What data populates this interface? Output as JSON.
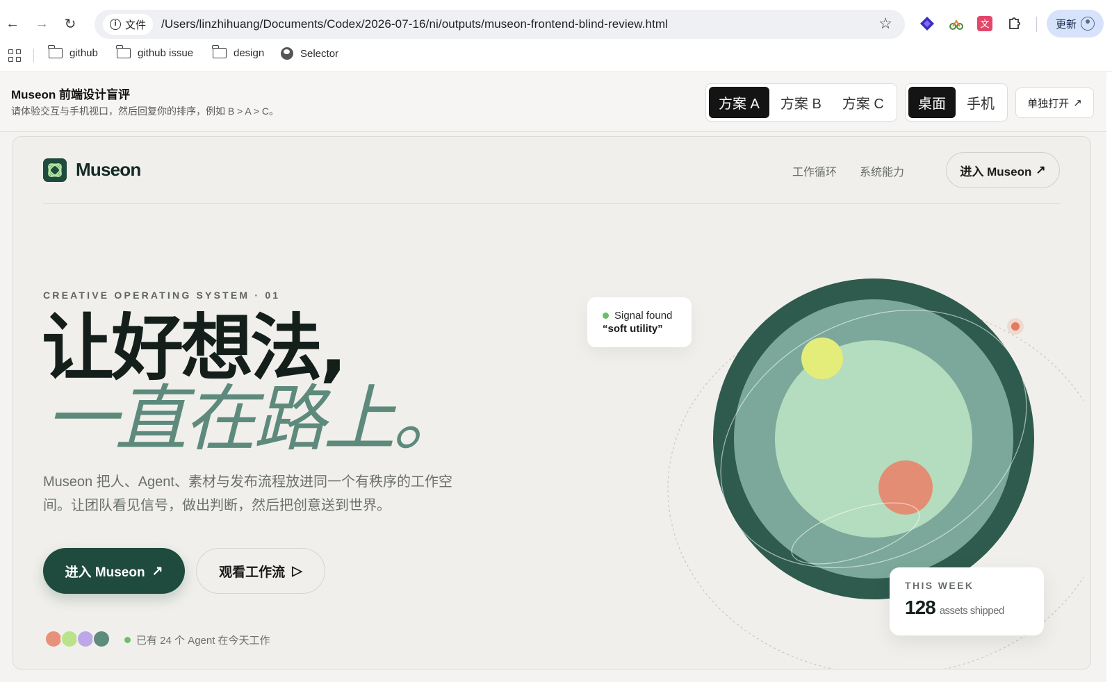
{
  "browser": {
    "omnibox_label": "文件",
    "url": "/Users/linzhihuang/Documents/Codex/2026-07-16/ni/outputs/museon-frontend-blind-review.html",
    "update_label": "更新",
    "bookmarks": [
      {
        "label": "github",
        "icon": "folder-icon"
      },
      {
        "label": "github issue",
        "icon": "folder-icon"
      },
      {
        "label": "design",
        "icon": "folder-icon"
      },
      {
        "label": "Selector",
        "icon": "globe-icon"
      }
    ]
  },
  "review": {
    "title": "Museon 前端设计盲评",
    "subtitle": "请体验交互与手机视口，然后回复你的排序，例如 B > A > C。",
    "variants": [
      "方案 A",
      "方案 B",
      "方案 C"
    ],
    "active_variant": "方案 A",
    "viewports": [
      "桌面",
      "手机"
    ],
    "active_viewport": "桌面",
    "open_label": "单独打开",
    "open_arrow": "↗"
  },
  "site": {
    "brand": "Museon",
    "nav": [
      "工作循环",
      "系统能力"
    ],
    "cta": "进入 Museon",
    "cta_arrow": "↗",
    "eyebrow": "CREATIVE OPERATING SYSTEM · 01",
    "headline_1": "让好想法,",
    "headline_2": "一直在路上。",
    "lead": "Museon 把人、Agent、素材与发布流程放进同一个有秩序的工作空间。让团队看见信号，做出判断，然后把创意送到世界。",
    "primary_button": "进入 Museon",
    "primary_arrow": "↗",
    "secondary_button": "观看工作流",
    "secondary_arrow": "▷",
    "agent_status": "已有 24 个 Agent 在今天工作",
    "avatar_colors": [
      "#e8907a",
      "#b9e28a",
      "#bca7e8",
      "#5e8c7c"
    ],
    "signal_label": "Signal found",
    "signal_quote": "“soft utility”",
    "week_label": "THIS WEEK",
    "week_value": "128",
    "week_unit": "assets shipped"
  },
  "colors": {
    "brand_green": "#1f4a3e",
    "accent_sage": "#5d8a7c",
    "orb_outer": "#2e5b4e",
    "orb_mid": "#7ba89a",
    "orb_inner": "#b4dcbe",
    "orb_yellow": "#e5ed7a",
    "orb_coral": "#e38d74"
  }
}
